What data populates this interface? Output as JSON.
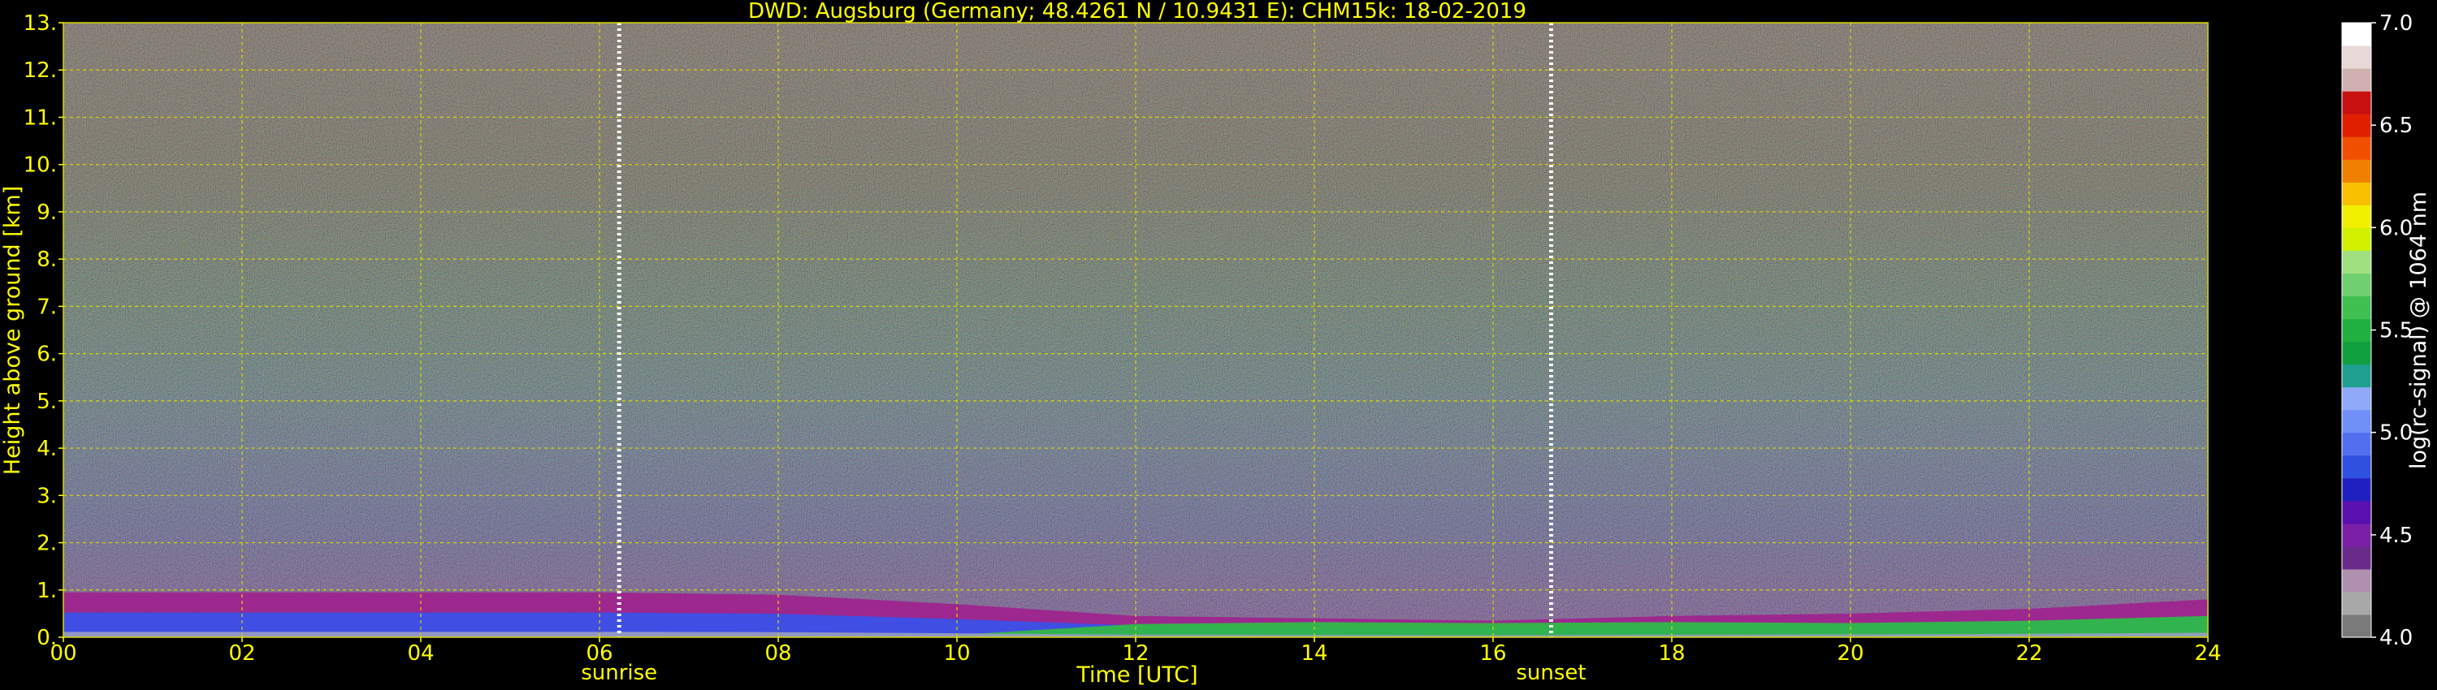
{
  "chart_data": [
    {
      "type": "heatmap",
      "title": "DWD: Augsburg (Germany; 48.4261 N / 10.9431 E):    CHM15k: 18-02-2019",
      "xlabel": "Time [UTC]",
      "ylabel": "Height above ground [km]",
      "xlim": [
        0,
        24
      ],
      "ylim": [
        0,
        13
      ],
      "x_ticks": [
        "00",
        "02",
        "04",
        "06",
        "08",
        "10",
        "12",
        "14",
        "16",
        "18",
        "20",
        "22",
        "24"
      ],
      "y_ticks": [
        "0.",
        "1.",
        "2.",
        "3.",
        "4.",
        "5.",
        "6.",
        "7.",
        "8.",
        "9.",
        "10.",
        "11.",
        "12.",
        "13."
      ],
      "grid": true,
      "grid_style": "dashed yellow",
      "annotations": [
        {
          "label": "sunrise",
          "x": 6.22
        },
        {
          "label": "sunset",
          "x": 16.65
        }
      ],
      "boundary_layer_top_km": {
        "x": [
          0,
          2,
          4,
          6,
          8,
          10,
          12,
          14,
          16,
          18,
          20,
          22,
          24
        ],
        "y": [
          0.95,
          0.95,
          0.95,
          0.95,
          0.9,
          0.7,
          0.45,
          0.4,
          0.35,
          0.45,
          0.5,
          0.6,
          0.8
        ]
      },
      "colorbar": {
        "label": "log(rc-signal) @ 1064 nm",
        "range": [
          4.0,
          7.0
        ],
        "ticks": [
          "4.0",
          "4.5",
          "5.0",
          "5.5",
          "6.0",
          "6.5",
          "7.0"
        ],
        "colors": [
          "#7a7a7a",
          "#a8a8a8",
          "#b090b0",
          "#6a2a8a",
          "#7a20a8",
          "#5a10b0",
          "#2020c0",
          "#3050e0",
          "#5070f0",
          "#7090f8",
          "#90a8f8",
          "#20a090",
          "#10a040",
          "#20b040",
          "#40c050",
          "#70d070",
          "#a0e080",
          "#d0f000",
          "#f0f000",
          "#f8c000",
          "#f08000",
          "#f05000",
          "#e02000",
          "#c81010",
          "#d0b0b0",
          "#e8d8d8",
          "#ffffff"
        ]
      }
    }
  ],
  "colors": {
    "text": "#ffff00",
    "background": "#000000",
    "grid": "#d8d800",
    "colorbar_text": "#ffffff"
  }
}
